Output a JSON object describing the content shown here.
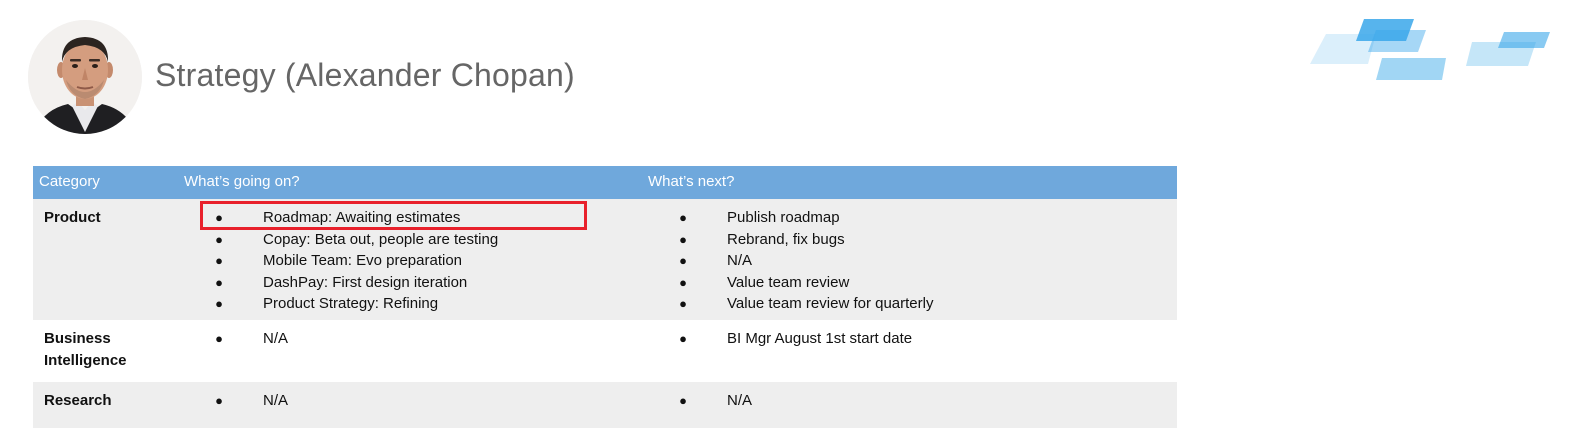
{
  "header": {
    "title": "Strategy (Alexander Chopan)",
    "avatar_alt": "profile photo",
    "logo_icon": "brand-logo-icon"
  },
  "colors": {
    "header_bg": "#6fa8dc",
    "row_shaded": "#eeeeee",
    "highlight": "#e8202b",
    "title_text": "#666666"
  },
  "table": {
    "columns": [
      "Category",
      "What’s going on?",
      "What’s next?"
    ],
    "rows": [
      {
        "category": "Product",
        "going": [
          "Roadmap: Awaiting estimates",
          "Copay: Beta out, people are testing",
          "Mobile Team: Evo preparation",
          "DashPay: First design iteration",
          "Product Strategy: Refining"
        ],
        "next": [
          "Publish roadmap",
          "Rebrand, fix bugs",
          "N/A",
          "Value team review",
          "Value team review for  quarterly"
        ]
      },
      {
        "category": "Business Intelligence",
        "going": [
          "N/A"
        ],
        "next": [
          "BI Mgr August 1st start date"
        ]
      },
      {
        "category": "Research",
        "going": [
          "N/A"
        ],
        "next": [
          "N/A"
        ]
      }
    ],
    "bullet": "●"
  }
}
